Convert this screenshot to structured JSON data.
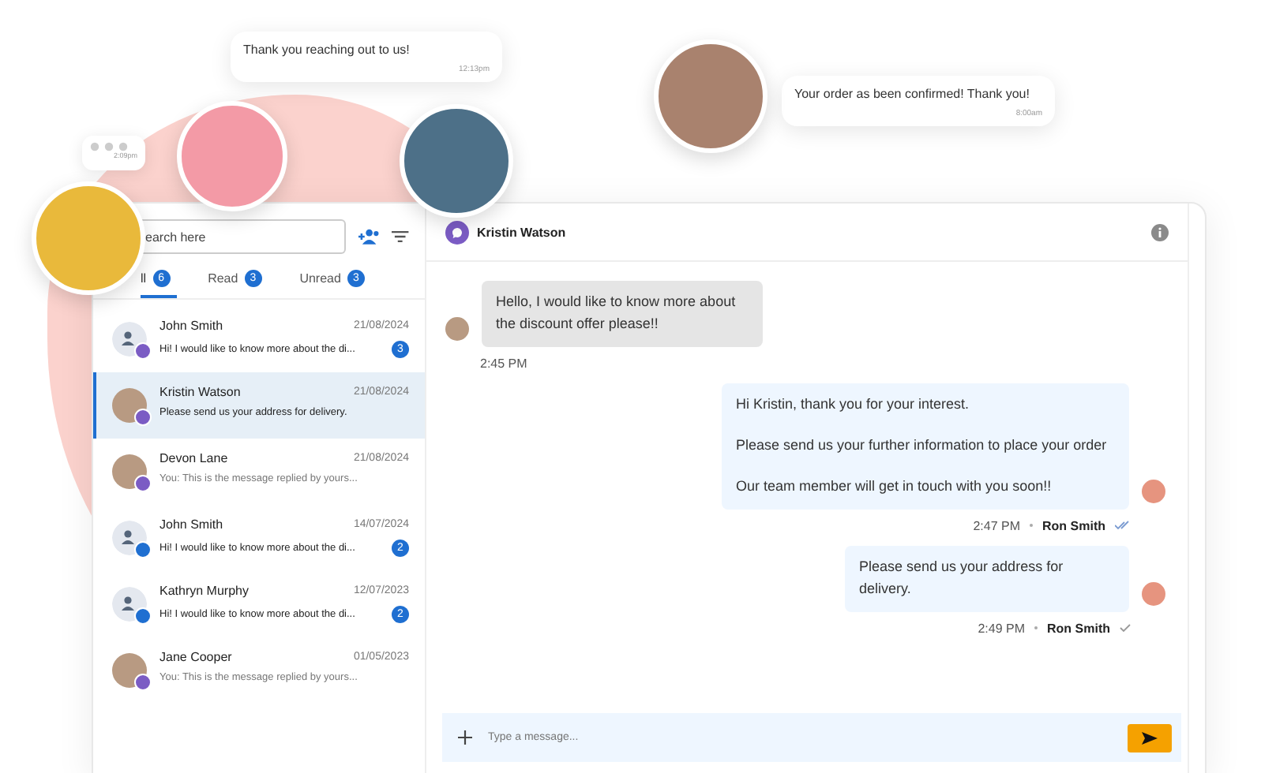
{
  "floating_bubbles": [
    {
      "text": "Thank you reaching out to us!",
      "time": "12:13pm"
    },
    {
      "text": "Your order as been confirmed! Thank you!",
      "time": "8:00am"
    }
  ],
  "typing_bubble": {
    "time": "2:09pm"
  },
  "search": {
    "placeholder": "earch here"
  },
  "tabs": [
    {
      "label": "ll",
      "count": "6",
      "selected": true
    },
    {
      "label": "Read",
      "count": "3",
      "selected": false
    },
    {
      "label": "Unread",
      "count": "3",
      "selected": false
    }
  ],
  "conversations": [
    {
      "name": "John Smith",
      "date": "21/08/2024",
      "preview": "Hi! I would like to know more about the di...",
      "count": "3",
      "kind": "generic",
      "color": "#7b5cc4",
      "replied": false,
      "selected": false
    },
    {
      "name": "Kristin Watson",
      "date": "21/08/2024",
      "preview": "Please send us your address for delivery.",
      "kind": "photo",
      "color": "#7b5cc4",
      "replied": false,
      "selected": true
    },
    {
      "name": "Devon Lane",
      "date": "21/08/2024",
      "preview": "You: This is the message replied by yours...",
      "kind": "photo",
      "color": "#7b5cc4",
      "replied": true,
      "selected": false
    },
    {
      "name": "John Smith",
      "date": "14/07/2024",
      "preview": "Hi! I would like to know more about the di...",
      "count": "2",
      "kind": "generic",
      "color": "#1f6fd1",
      "replied": false,
      "selected": false
    },
    {
      "name": "Kathryn Murphy",
      "date": "12/07/2023",
      "preview": "Hi! I would like to know more about the di...",
      "count": "2",
      "kind": "generic",
      "color": "#1f6fd1",
      "replied": false,
      "selected": false
    },
    {
      "name": "Jane Cooper",
      "date": "01/05/2023",
      "preview": "You: This is the message replied by yours...",
      "kind": "photo",
      "color": "#7b5cc4",
      "replied": true,
      "selected": false
    }
  ],
  "chat": {
    "contact": "Kristin Watson",
    "messages": [
      {
        "kind": "incoming",
        "lines": [
          "Hello, I would like to know more about the discount offer please!!"
        ],
        "time": "2:45 PM"
      },
      {
        "kind": "outgoing",
        "lines": [
          "Hi Kristin, thank you for your interest.",
          "Please send us your further information to place your order",
          "Our team member will get in touch with you soon!!"
        ],
        "time": "2:47 PM",
        "sender": "Ron Smith",
        "read": true
      },
      {
        "kind": "outgoing",
        "lines": [
          "Please send us your address for delivery."
        ],
        "time": "2:49 PM",
        "sender": "Ron Smith",
        "read": false
      }
    ],
    "input": {
      "placeholder": "Type a message..."
    }
  }
}
